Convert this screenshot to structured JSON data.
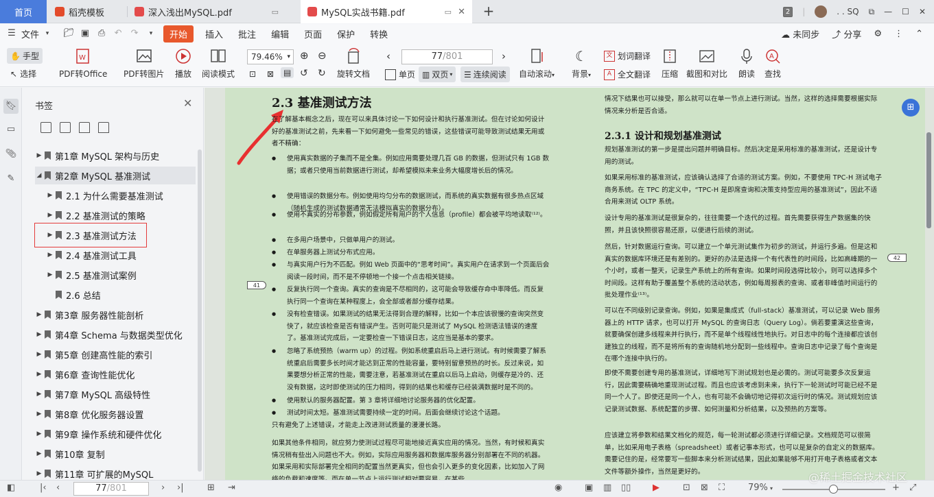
{
  "tabs": [
    {
      "label": "首页"
    },
    {
      "label": "稻壳模板"
    },
    {
      "label": "深入浅出MySQL.pdf"
    },
    {
      "label": "MySQL实战书籍.pdf"
    }
  ],
  "window": {
    "count_badge": "2",
    "user": ". . SQ"
  },
  "menu": {
    "file": "文件",
    "items": [
      "开始",
      "插入",
      "批注",
      "编辑",
      "页面",
      "保护",
      "转换"
    ],
    "sync": "未同步",
    "share": "分享"
  },
  "toolbar": {
    "hand": "手型",
    "select": "选择",
    "pdf_office": "PDF转Office",
    "pdf_image": "PDF转图片",
    "play": "播放",
    "read_mode": "阅读模式",
    "zoom": "79.46%",
    "rotate": "旋转文档",
    "page_current": "77",
    "page_total": "/801",
    "single": "单页",
    "double": "双页",
    "continuous": "连续阅读",
    "autoscroll": "自动滚动",
    "background": "背景",
    "word_translate": "划词翻译",
    "full_translate": "全文翻译",
    "compress": "压缩",
    "screenshot": "截图和对比",
    "read_aloud": "朗读",
    "find": "查找"
  },
  "bookmarks": {
    "title": "书签",
    "items": [
      {
        "label": "第1章 MySQL 架构与历史",
        "level": 0
      },
      {
        "label": "第2章 MySQL 基准测试",
        "level": 0
      },
      {
        "label": "2.1 为什么需要基准测试",
        "level": 1
      },
      {
        "label": "2.2 基准测试的策略",
        "level": 1
      },
      {
        "label": "2.3 基准测试方法",
        "level": 1
      },
      {
        "label": "2.4 基准测试工具",
        "level": 1
      },
      {
        "label": "2.5 基准测试案例",
        "level": 1
      },
      {
        "label": "2.6 总结",
        "level": 1
      },
      {
        "label": "第3章 服务器性能剖析",
        "level": 0
      },
      {
        "label": "第4章 Schema 与数据类型优化",
        "level": 0
      },
      {
        "label": "第5章 创建高性能的索引",
        "level": 0
      },
      {
        "label": "第6章 查询性能优化",
        "level": 0
      },
      {
        "label": "第7章 MySQL 高级特性",
        "level": 0
      },
      {
        "label": "第8章 优化服务器设置",
        "level": 0
      },
      {
        "label": "第9章 操作系统和硬件优化",
        "level": 0
      },
      {
        "label": "第10章 复制",
        "level": 0
      },
      {
        "label": "第11章 可扩展的MySQL",
        "level": 0
      }
    ]
  },
  "doc": {
    "left": {
      "heading": "2.3 基准测试方法",
      "intro": "在了解基本概念之后，现在可以来具体讨论一下如何设计和执行基准测试。但在讨论如何设计好的基准测试之前，先来看一下如何避免一些常见的错误，这些错误可能导致测试结果无用或者不精确：",
      "bullets": [
        "使用真实数据的子集而不是全集。例如应用需要处理几百 GB 的数据，但测试只有 1GB 数据；或者只使用当前数据进行测试，却希望模拟未来业务大幅度增长后的情况。",
        "使用错误的数据分布。例如使用均匀分布的数据测试，而系统的真实数据有很多热点区域（随机生成的测试数据通常无法模拟真实的数据分布）。",
        "使用不真实的分布参数，例如假定所有用户的个人信息（profile）都会被平均地读取⁽¹²⁾。",
        "在多用户场景中，只做单用户的测试。",
        "在单服务器上测试分布式应用。",
        "与真实用户行为不匹配。例如 Web 页面中的“思考时间”。真实用户在请求到一个页面后会阅读一段时间，而不是不停顿地一个接一个点击相关链接。",
        "反复执行同一个查询。真实的查询是不尽相同的，这可能会导致缓存命中率降低。而反复执行同一个查询在某种程度上，会全部或者部分缓存结果。",
        "没有检查错误。如果测试的结果无法得到合理的解释，比如一个本应该很慢的查询突然变快了，就应该检查是否有错误产生。否则可能只是测试了 MySQL 检测语法错误的速度了。基准测试完成后，一定要检查一下错误日志，这应当是基本的要求。",
        "忽略了系统预热（warm up）的过程。例如系统重启后马上进行测试。有时候需要了解系统重启后需要多长时间才能达到正常的性能容量，要特别留意预热的时长。反过来说，如果要想分析正常的性能，需要注意，若基准测试在重启以后马上启动，则缓存是冷的、还没有数据，这时即使测试的压力相同，得到的结果也和缓存已经装满数据时是不同的。",
        "使用默认的服务器配置。第 3 章将详细地讨论服务器的优化配置。",
        "测试时间太短。基准测试需要持续一定的时间。后面会继续讨论这个话题。"
      ],
      "after": "只有避免了上述错误，才能走上改进测试质量的漫漫长路。",
      "para2": "如果其他条件相同，就应努力使测试过程尽可能地接近真实应用的情况。当然，有时候和真实情况稍有些出入问题也不大。例如，实际应用服务器和数据库服务器分别部署在不同的机器。如果采用和实际部署完全相同的配置当然更真实，但也会引入更多的变化因素，比如加入了网络的负载和速度等。而在单一节点上运行测试相对要容易，在某些",
      "page_tag": "41"
    },
    "right": {
      "top": "情况下结果也可以接受，那么就可以在单一节点上进行测试。当然，这样的选择需要根据实际情况来分析是否合适。",
      "heading": "2.3.1 设计和规划基准测试",
      "p1": "规划基准测试的第一步是提出问题并明确目标。然后决定是采用标准的基准测试，还是设计专用的测试。",
      "p2": "如果采用标准的基准测试，应该确认选择了合适的测试方案。例如，不要使用 TPC-H 测试电子商务系统。在 TPC 的定义中，“TPC-H 是即席查询和决策支持型应用的基准测试”，因此不适合用来测试 OLTP 系统。",
      "p3": "设计专用的基准测试是很复杂的，往往需要一个迭代的过程。首先需要获得生产数据集的快照，并且该快照很容易还原，以便进行后续的测试。",
      "p4": "然后，针对数据运行查询。可以建立一个单元测试集作为初步的测试，并运行多遍。但是这和真实的数据库环境还是有差别的。更好的办法是选择一个有代表性的时间段，比如高峰期的一个小时，或者一整天，记录生产系统上的所有查询。如果时间段选得比较小，则可以选择多个时间段。这样有助于覆盖整个系统的活动状态，例如每周报表的查询、或者非峰值时间运行的批处理作业⁽¹³⁾。",
      "p5": "可以在不同级别记录查询。例如，如果是集成式（full-stack）基准测试，可以记录 Web 服务器上的 HTTP 请求，也可以打开 MySQL 的查询日志（Query Log）。倘若要重演这些查询，就要确保创建多线程来并行执行，而不是单个线程线性地执行。对日志中的每个连接都应该创建独立的线程，而不是将所有的查询随机地分配到一些线程中。查询日志中记录了每个查询是在哪个连接中执行的。",
      "p6": "即使不需要创建专用的基准测试，详细地写下测试规划也是必需的。测试可能要多次反复运行，因此需要精确地重现测试过程。而且也应该考虑到未来，执行下一轮测试时可能已经不是同一个人了。即使还是同一个人，也有可能不会确切地记得初次运行时的情况。测试规划应该记录测试数据、系统配置的步骤、如何测量和分析结果，以及预热的方案等。",
      "p7": "应该建立将参数和结果文档化的规范，每一轮测试都必须进行详细记录。文档规范可以很简单，比如采用电子表格（spreadsheet）或者记事本形式，也可以是复杂的自定义的数据库。需要记住的是，经常要写一些脚本来分析测试结果，因此如果能够不用打开电子表格或者文本文件等额外操作，当然是更好的。",
      "page_tag": "42"
    }
  },
  "status": {
    "page_current": "77",
    "page_total": "/801",
    "zoom": "79%",
    "watermark": "@稀土掘金技术社区"
  },
  "colors": {
    "accent": "#4a7cdc",
    "start": "#e8582c",
    "page_bg": "#cfe3c8",
    "highlight": "#e43a3a"
  }
}
